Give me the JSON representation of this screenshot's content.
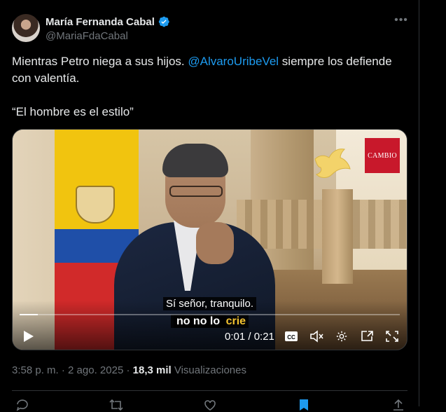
{
  "author": {
    "display_name": "María Fernanda Cabal",
    "handle": "@MariaFdaCabal",
    "verified_color": "#1d9bf0"
  },
  "tweet": {
    "text_before": "Mientras Petro niega a sus hijos. ",
    "mention": "@AlvaroUribeVel",
    "text_after": " siempre los defiende con valentía.",
    "quote": "“El hombre es el estilo”"
  },
  "video": {
    "logo_text": "CAMBIO",
    "caption_line1": "Sí señor, tranquilo.",
    "caption_line2_prefix": "no no lo ",
    "caption_line2_highlight": "crie",
    "time_display": "0:01 / 0:21",
    "progress": 0.048,
    "icons": [
      "play-icon",
      "closed-captions-icon",
      "mute-icon",
      "settings-icon",
      "picture-in-picture-icon",
      "fullscreen-icon"
    ]
  },
  "meta": {
    "time": "3:58 p. m.",
    "separator": " · ",
    "date": "2 ago. 2025",
    "views_count": "18,3 mil",
    "views_label": " Visualizaciones"
  },
  "colors": {
    "background": "#000000",
    "text": "#e7e9ea",
    "secondary": "#71767b",
    "accent": "#1d9bf0",
    "caption_highlight": "#f2c230",
    "logo_red": "#c8182b"
  }
}
